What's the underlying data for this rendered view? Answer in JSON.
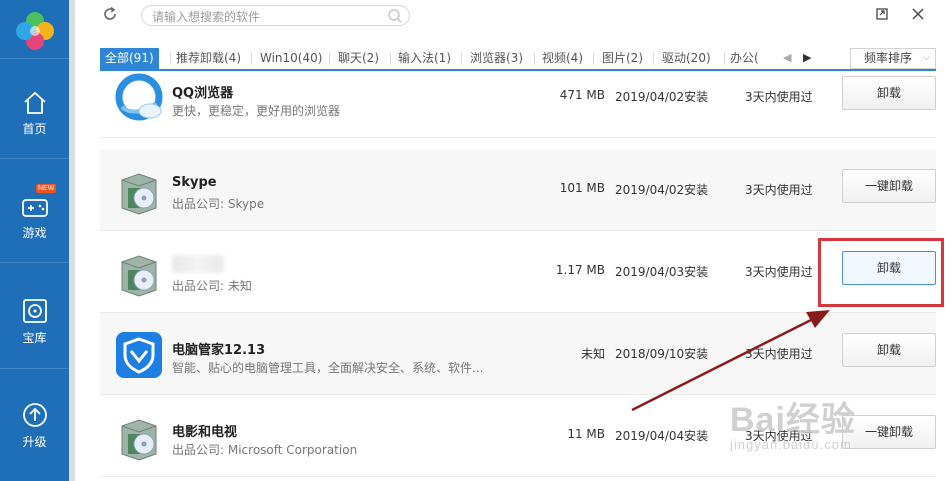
{
  "sidebar": {
    "items": [
      {
        "label": "首页",
        "icon": "home-icon"
      },
      {
        "label": "游戏",
        "icon": "gamepad-icon",
        "badge": "NEW"
      },
      {
        "label": "宝库",
        "icon": "disc-icon"
      },
      {
        "label": "升级",
        "icon": "upgrade-icon"
      }
    ],
    "accent": "#1e6fb8"
  },
  "search": {
    "placeholder": "请输入想搜索的软件"
  },
  "tabs": [
    {
      "label": "全部(91)",
      "active": true
    },
    {
      "label": "推荐卸载(4)"
    },
    {
      "label": "Win10(40)"
    },
    {
      "label": "聊天(2)"
    },
    {
      "label": "输入法(1)"
    },
    {
      "label": "浏览器(3)"
    },
    {
      "label": "视频(4)"
    },
    {
      "label": "图片(2)"
    },
    {
      "label": "驱动(20)"
    },
    {
      "label": "办公("
    }
  ],
  "sort": {
    "selected": "频率排序"
  },
  "apps": [
    {
      "name": "QQ浏览器",
      "desc": "更快，更稳定，更好用的浏览器",
      "size": "471 MB",
      "date": "2019/04/02安装",
      "usage": "3天内使用过",
      "button": "卸载",
      "icon": "qq-browser-icon"
    },
    {
      "name": "Skype",
      "desc": "出品公司: Skype",
      "size": "101 MB",
      "date": "2019/04/02安装",
      "usage": "3天内使用过",
      "button": "一键卸载",
      "icon": "installer-box-icon"
    },
    {
      "name": "",
      "desc": "出品公司: 未知",
      "size": "1.17 MB",
      "date": "2019/04/03安装",
      "usage": "3天内使用过",
      "button": "卸载",
      "icon": "installer-box-icon"
    },
    {
      "name": "电脑管家12.13",
      "desc": "智能、贴心的电脑管理工具，全面解决安全、系统、软件...",
      "size": "未知",
      "date": "2018/09/10安装",
      "usage": "3天内使用过",
      "button": "卸载",
      "icon": "pc-manager-shield-icon"
    },
    {
      "name": "电影和电视",
      "desc": "出品公司: Microsoft Corporation",
      "size": "11 MB",
      "date": "2019/04/04安装",
      "usage": "3天内使用过",
      "button": "一键卸载",
      "icon": "installer-box-icon"
    }
  ],
  "watermark": {
    "main": "Bai经验",
    "sub": "jingyan.baidu.com"
  },
  "colors": {
    "tab_active": "#2f86d6",
    "annotation": "#d8373d",
    "arrow": "#8b1a1a"
  }
}
